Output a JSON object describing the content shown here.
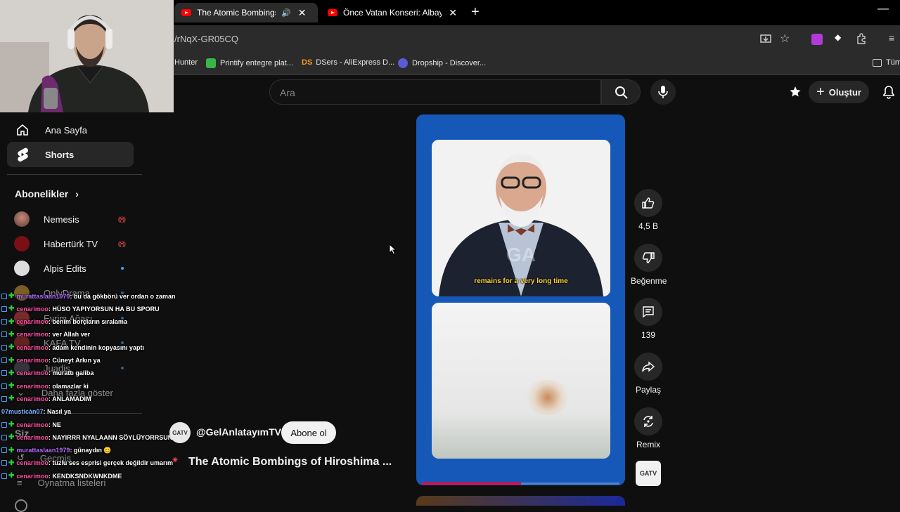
{
  "browser": {
    "tabs": [
      {
        "title": "The Atomic Bombings o",
        "active": true
      },
      {
        "title": "Önce Vatan Konseri: Albay Erha",
        "active": false
      }
    ],
    "url": "/rNqX-GR05CQ",
    "bookmarks": [
      "Hunter",
      "Printify entegre plat...",
      "DSers - AliExpress D...",
      "Dropship - Discover...",
      "Tüm"
    ],
    "bookmark_ds_label": "DS"
  },
  "youtube": {
    "search_placeholder": "Ara",
    "create_label": "Oluştur"
  },
  "sidebar": {
    "items": [
      {
        "label": "Ana Sayfa"
      },
      {
        "label": "Shorts"
      }
    ],
    "subscriptions_title": "Abonelikler",
    "subscriptions": [
      {
        "label": "Nemesis",
        "status": "live"
      },
      {
        "label": "Habertürk TV",
        "status": "live"
      },
      {
        "label": "Alpis Edits",
        "status": "new"
      },
      {
        "label": "OnlyDrama",
        "status": "new"
      },
      {
        "label": "Evrim Ağacı",
        "status": "new"
      },
      {
        "label": "KAFA TV",
        "status": "new"
      },
      {
        "label": "Juadis",
        "status": "new"
      }
    ],
    "show_more": "Daha fazla göster",
    "you_label": "Siz",
    "history": "Geçmiş",
    "playlists": "Oynatma listeleri"
  },
  "chat": [
    {
      "user": "murattaslaan1979",
      "msg": ": bu da gökbörü ver ordan o zaman",
      "color": "#b36bff"
    },
    {
      "user": "cenarimoo",
      "msg": ": HÜSO YAPIYORSUN HA BU SPORU",
      "color": "#ff4fa3"
    },
    {
      "user": "cenarimoo",
      "msg": ": benim borçların sıralama",
      "color": "#ff4fa3"
    },
    {
      "user": "cenarimoo",
      "msg": ": ver Allah ver",
      "color": "#ff4fa3"
    },
    {
      "user": "cenarimoo",
      "msg": ": adam kendinin kopyasını yaptı",
      "color": "#ff4fa3"
    },
    {
      "user": "cenarimoo",
      "msg": ": Cüneyt Arkın ya",
      "color": "#ff4fa3"
    },
    {
      "user": "cenarimoo",
      "msg": ": murattı galiba",
      "color": "#ff4fa3"
    },
    {
      "user": "cenarimoo",
      "msg": ": olamazlar ki",
      "color": "#ff4fa3"
    },
    {
      "user": "cenarimoo",
      "msg": ": ANLAMADIM",
      "color": "#ff4fa3"
    },
    {
      "user": "07musticàn07",
      "msg": ": Nasıl ya",
      "color": "#7ab3ff"
    },
    {
      "user": "cenarimoo",
      "msg": ": NE",
      "color": "#ff4fa3"
    },
    {
      "user": "cenarimoo",
      "msg": ": NAYIRRR NYALAANN SÖYLÜYORRSUN",
      "color": "#ff4fa3"
    },
    {
      "user": "murattaslaan1979",
      "msg": ": günaydın 😊",
      "color": "#b36bff"
    },
    {
      "user": "cenarimoo",
      "msg": ": tuzlu ses esprisi gerçek değildir umarım",
      "color": "#ff4fa3"
    },
    {
      "user": "cenarimoo",
      "msg": ": KENDKSNDKWNKDME",
      "color": "#ff4fa3"
    }
  ],
  "short": {
    "caption": "remains for a very long time",
    "watermark": "GA",
    "channel": "@GelAnlatayımTV",
    "subscribe": "Abone ol",
    "title": "The Atomic Bombings of Hiroshima ...",
    "channel_avatar_text": "GATV",
    "progress": 0.5
  },
  "actions": {
    "likes": "4,5 B",
    "dislike": "Beğenme",
    "comments": "139",
    "share": "Paylaş",
    "remix": "Remix"
  }
}
